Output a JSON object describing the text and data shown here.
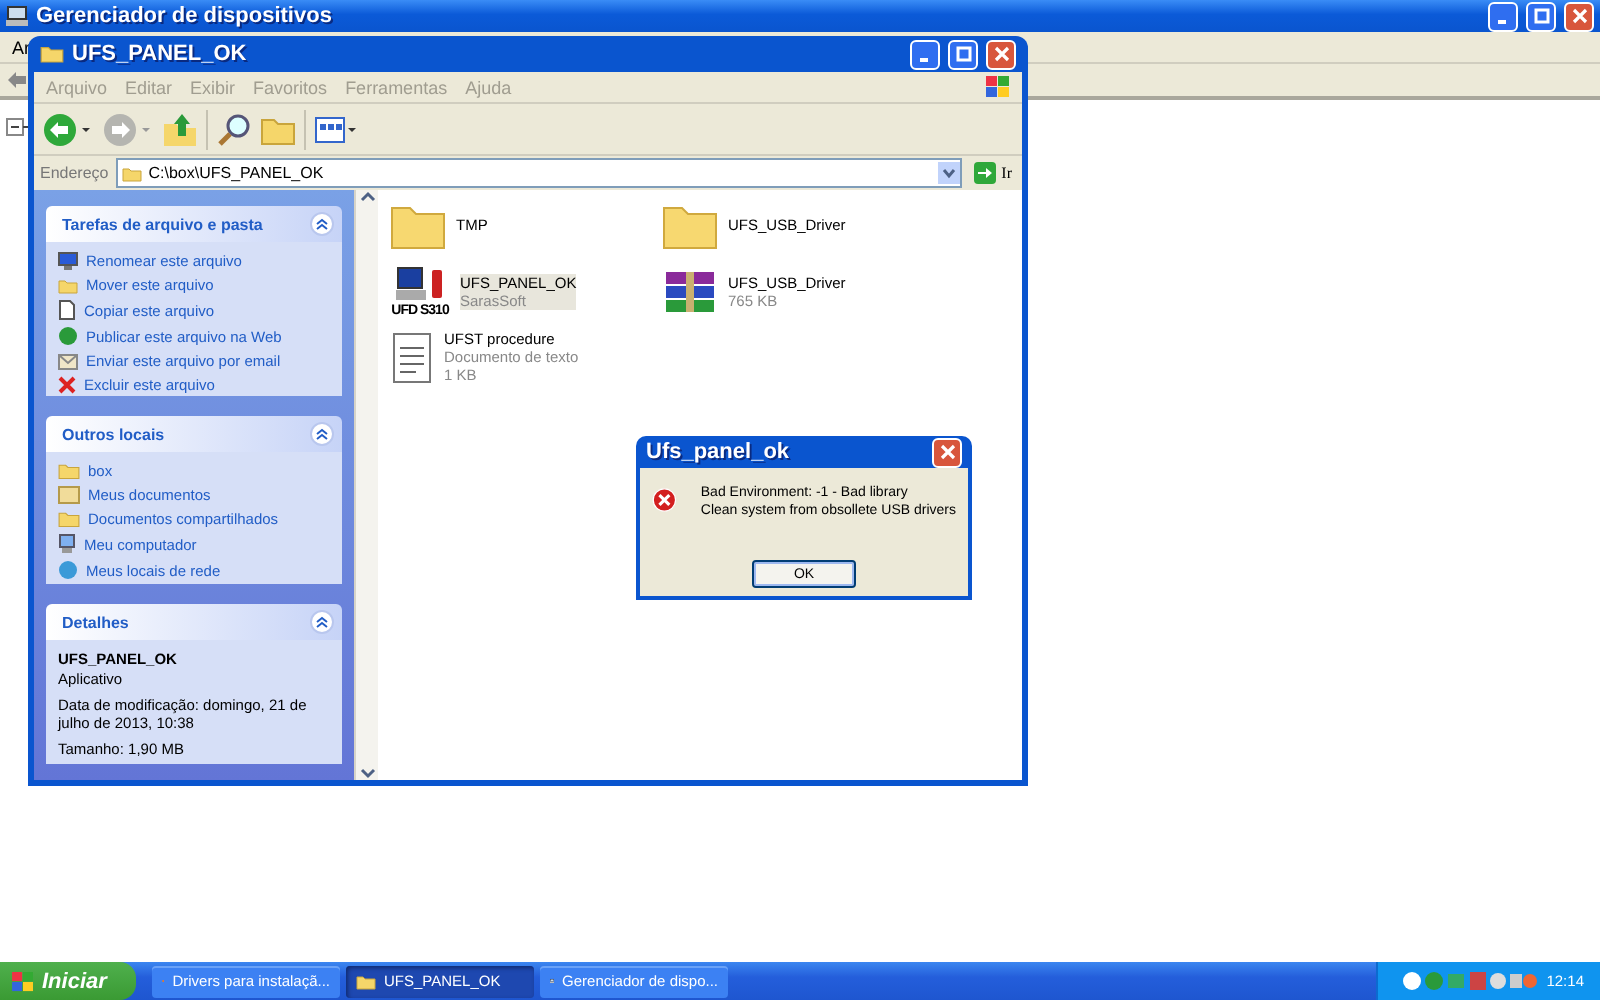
{
  "background_window": {
    "title": "Gerenciador de dispositivos",
    "menu": [
      "Ar"
    ]
  },
  "explorer": {
    "title": "UFS_PANEL_OK",
    "menu": [
      "Arquivo",
      "Editar",
      "Exibir",
      "Favoritos",
      "Ferramentas",
      "Ajuda"
    ],
    "address_label": "Endereço",
    "address": "C:\\box\\UFS_PANEL_OK",
    "go": "Ir",
    "panels": [
      {
        "title": "Tarefas de arquivo e pasta",
        "items": [
          "Renomear este arquivo",
          "Mover este arquivo",
          "Copiar este arquivo",
          "Publicar este arquivo na Web",
          "Enviar este arquivo por email",
          "Excluir este arquivo"
        ]
      },
      {
        "title": "Outros locais",
        "items": [
          "box",
          "Meus documentos",
          "Documentos compartilhados",
          "Meu computador",
          "Meus locais de rede"
        ]
      }
    ],
    "details": {
      "title": "Detalhes",
      "name": "UFS_PANEL_OK",
      "type": "Aplicativo",
      "modified": "Data de modificação: domingo, 21 de julho de 2013, 10:38",
      "size": "Tamanho: 1,90 MB"
    },
    "files": [
      {
        "name": "TMP",
        "kind": "folder",
        "selected": false
      },
      {
        "name": "UFS_USB_Driver",
        "kind": "folder",
        "selected": false
      },
      {
        "name": "UFS_PANEL_OK",
        "kind": "app",
        "badge": "UFD S310",
        "lines": [
          "SarasSoft"
        ],
        "selected": true
      },
      {
        "name": "UFS_USB_Driver",
        "kind": "archive",
        "lines": [
          "765 KB"
        ],
        "selected": false
      },
      {
        "name": "UFST procedure",
        "kind": "text",
        "lines": [
          "Documento de texto",
          "1 KB"
        ],
        "selected": false
      }
    ]
  },
  "dialog": {
    "title": "Ufs_panel_ok",
    "lines": [
      "Bad Environment: -1 - Bad library",
      "Clean system from obsollete USB drivers"
    ],
    "button": "OK"
  },
  "taskbar": {
    "start": "Iniciar",
    "tasks": [
      {
        "label": "Drivers para instalaçã...",
        "selected": false
      },
      {
        "label": "UFS_PANEL_OK",
        "selected": true
      },
      {
        "label": "Gerenciador de dispo...",
        "selected": false
      }
    ],
    "clock": "12:14"
  }
}
